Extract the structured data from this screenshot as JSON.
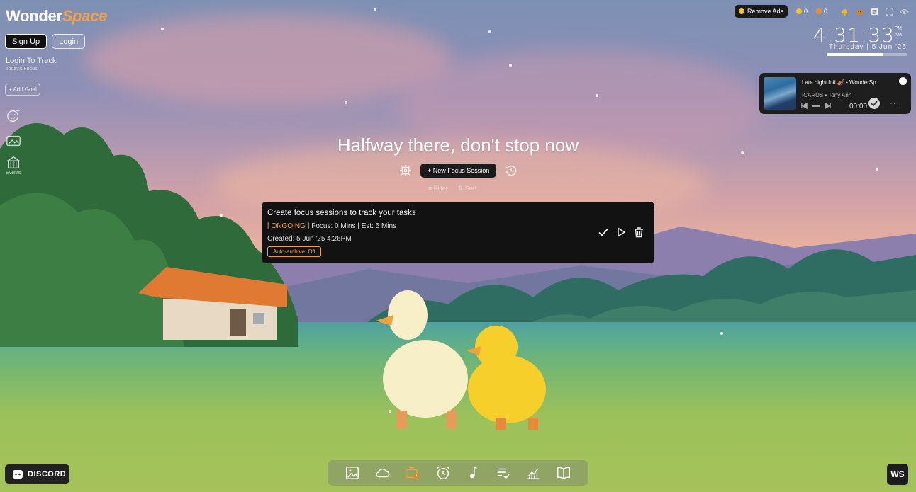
{
  "brand": {
    "logo_part1": "Wonder",
    "logo_part2": "Space"
  },
  "auth": {
    "signup_label": "Sign Up",
    "login_label": "Login"
  },
  "focus": {
    "login_to_track": "Login To Track",
    "todays_focus": "Today's Focus",
    "add_goal_label": "+ Add Goal"
  },
  "sidebar": {
    "events_label": "Events"
  },
  "topbar": {
    "remove_ads_label": "Remove Ads",
    "coins_gold": "0",
    "coins_orange": "0",
    "icons": [
      "bell-icon",
      "mascot-icon",
      "notes-icon",
      "fullscreen-icon",
      "eye-icon"
    ]
  },
  "clock": {
    "time": "4:31:33",
    "am": "AM",
    "pm": "PM",
    "date": "Thursday | 5 Jun '25",
    "day_progress": 0.69
  },
  "music": {
    "track": "Late night lofi 🎻 • WonderSp",
    "artist": "ICARUS • Tony Ann",
    "time": "00:00",
    "more": "···"
  },
  "center": {
    "motivation": "Halfway there, don't stop now",
    "new_session_label": "+ New Focus Session",
    "filter_label": "Filter",
    "sort_label": "Sort"
  },
  "task": {
    "title": "Create focus sessions to track your tasks",
    "status": "[ ONGOING ]",
    "details": " Focus: 0 Mins | Est: 5 Mins",
    "created": "Created: 5 Jun '25 4:26PM",
    "auto_archive": "Auto-archive: Off"
  },
  "bottom": {
    "discord_label": "DISCORD",
    "ws_badge": "WS",
    "dock": [
      "image-icon",
      "cloud-icon",
      "briefcase-clock-icon",
      "alarm-icon",
      "music-note-icon",
      "checklist-icon",
      "stats-chart-icon",
      "book-icon"
    ]
  },
  "colors": {
    "accent": "#f0a14a",
    "card_bg": "#121212",
    "coin_gold": "#f5c42a"
  }
}
